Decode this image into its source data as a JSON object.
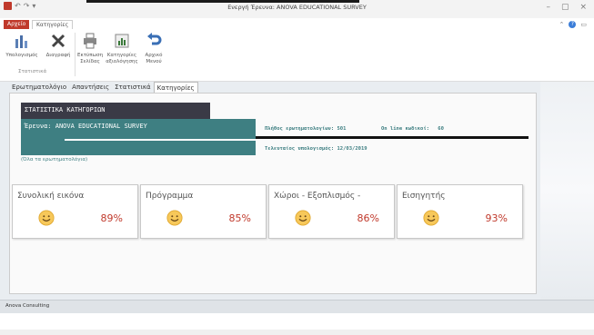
{
  "window": {
    "title": "Ενεργή Έρευνα: ANOVA EDUCATIONAL SURVEY",
    "controls": [
      "–",
      "▢",
      "×"
    ]
  },
  "quick_access": [
    "↶",
    "↷",
    "▾"
  ],
  "ribbon": {
    "tabs": [
      {
        "label": "Αρχείο",
        "active": false
      },
      {
        "label": "Κατηγορίες",
        "active": true
      }
    ],
    "buttons": [
      {
        "label_line1": "Υπολογισμός",
        "label_line2": "",
        "icon": "chart-icon"
      },
      {
        "label_line1": "Διαγραφή",
        "label_line2": "",
        "icon": "delete-icon"
      },
      {
        "label_line1": "Εκτύπωση",
        "label_line2": "Σελίδας",
        "icon": "print-icon"
      },
      {
        "label_line1": "Κατηγορίες",
        "label_line2": "αξιολόγησης",
        "icon": "categories-icon"
      },
      {
        "label_line1": "Αρχικό",
        "label_line2": "Μενού",
        "icon": "back-arrow-icon"
      }
    ],
    "group_label": "Στατιστικά"
  },
  "doc_tabs": [
    {
      "label": "Ερωτηματολόγιο",
      "active": false
    },
    {
      "label": "Απαντήσεις",
      "active": false
    },
    {
      "label": "Στατιστικά",
      "active": false
    },
    {
      "label": "Κατηγορίες",
      "active": true
    }
  ],
  "header": {
    "title": "ΣΤΑΤΙΣΤΙΚΑ ΚΑΤΗΓΟΡΙΩΝ",
    "survey_label": "Έρευνα:",
    "survey_name": "ANOVA EDUCATIONAL SURVEY"
  },
  "stats": {
    "questionnaires_label": "Πλήθος ερωτηματολογίων:",
    "questionnaires_value": "501",
    "online_label": "On line κωδικοί:",
    "online_value": "60",
    "last_calc_label": "Τελευταίος υπολογισμός:",
    "last_calc_value": "12/03/2019"
  },
  "filter_text": "(Όλα τα ερωτηματολόγια)",
  "cards": [
    {
      "label": "Συνολική εικόνα",
      "percent": "89%"
    },
    {
      "label": "Πρόγραμμα",
      "percent": "85%"
    },
    {
      "label": "Χώροι - Εξοπλισμός -",
      "percent": "86%"
    },
    {
      "label": "Εισηγητής",
      "percent": "93%"
    }
  ],
  "status_bar": {
    "text": "Anova Consulting"
  },
  "colors": {
    "teal": "#3e7f82",
    "dark_header": "#3a3a46",
    "percent_red": "#c0392b",
    "emoji_yellow": "#f7c85a"
  }
}
